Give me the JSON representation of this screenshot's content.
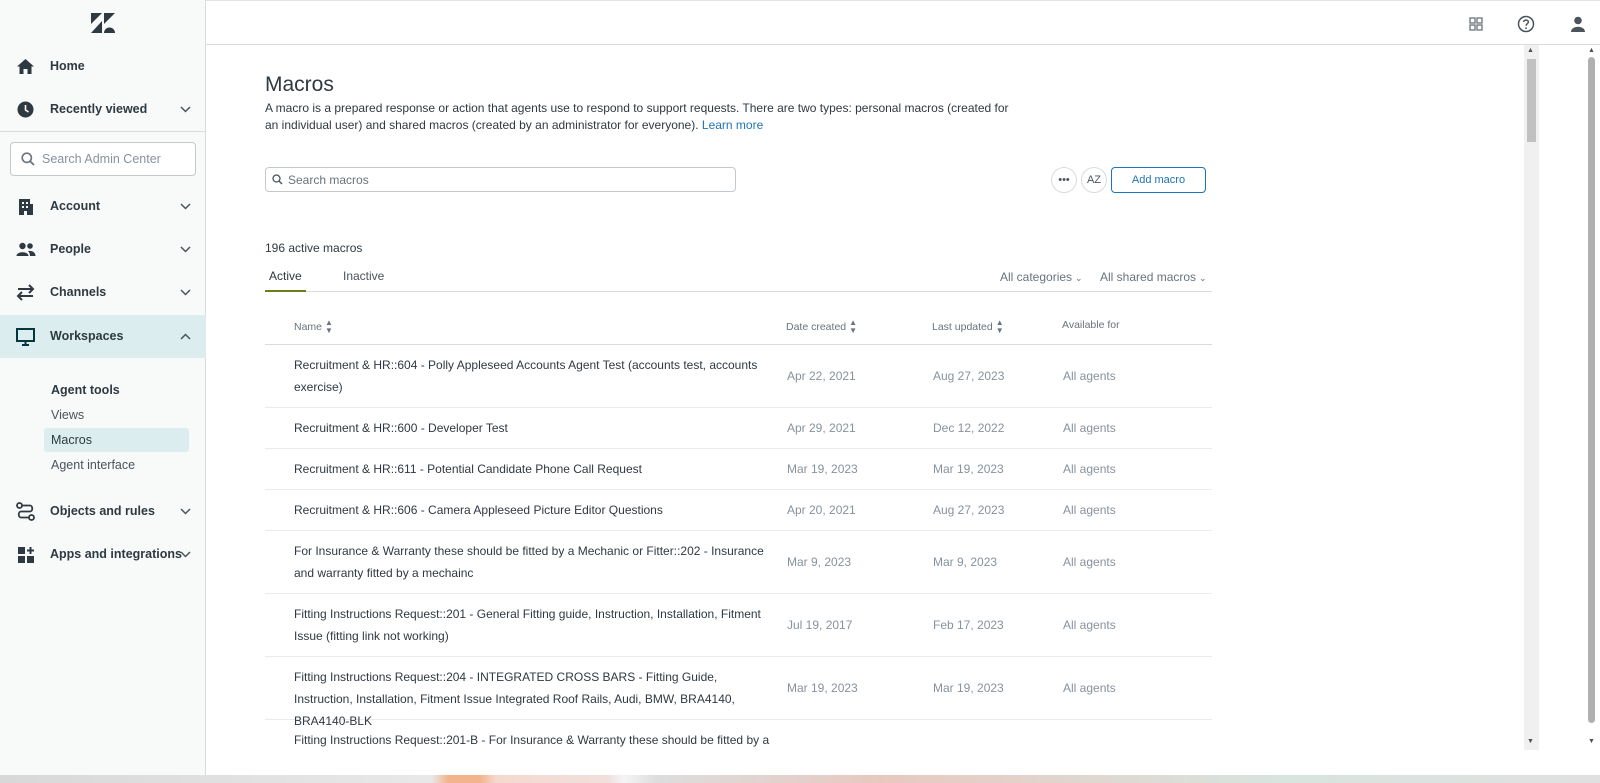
{
  "sidebar": {
    "logo": "zendesk-logo",
    "nav_top": [
      {
        "label": "Home",
        "icon": "home-icon"
      },
      {
        "label": "Recently viewed",
        "icon": "clock-icon"
      }
    ],
    "search_placeholder": "Search Admin Center",
    "nav": [
      {
        "label": "Account",
        "icon": "building-icon"
      },
      {
        "label": "People",
        "icon": "people-icon"
      },
      {
        "label": "Channels",
        "icon": "arrows-icon"
      },
      {
        "label": "Workspaces",
        "icon": "monitor-icon"
      },
      {
        "label": "Objects and rules",
        "icon": "route-icon"
      },
      {
        "label": "Apps and integrations",
        "icon": "apps-icon"
      }
    ],
    "workspaces_sub": {
      "heading": "Agent tools",
      "items": [
        "Views",
        "Macros",
        "Agent interface"
      ],
      "selected": "Macros"
    },
    "active_color": "#dbedee"
  },
  "topbar": {
    "icons": [
      "grid-icon",
      "help-icon",
      "user-icon"
    ]
  },
  "page": {
    "title": "Macros",
    "description": "A macro is a prepared response or action that agents use to respond to support requests. There are two types: personal macros (created for an individual user) and shared macros (created by an administrator for everyone).",
    "learn_more": "Learn more",
    "search_placeholder": "Search macros",
    "more_label": "•••",
    "sort_label": "AZ",
    "add_button": "Add macro",
    "count": "196 active macros",
    "tabs": [
      {
        "label": "Active",
        "active": true
      },
      {
        "label": "Inactive",
        "active": false
      }
    ],
    "filters": [
      "All categories",
      "All shared macros"
    ],
    "columns": [
      "Name",
      "Date created",
      "Last updated",
      "Available for"
    ],
    "rows": [
      {
        "name": "Recruitment & HR::604 - Polly Appleseed Accounts Agent Test (accounts test, accounts exercise)",
        "created": "Apr 22, 2021",
        "updated": "Aug 27, 2023",
        "available": "All agents"
      },
      {
        "name": "Recruitment & HR::600 - Developer Test",
        "created": "Apr 29, 2021",
        "updated": "Dec 12, 2022",
        "available": "All agents"
      },
      {
        "name": "Recruitment & HR::611 - Potential Candidate Phone Call Request",
        "created": "Mar 19, 2023",
        "updated": "Mar 19, 2023",
        "available": "All agents"
      },
      {
        "name": "Recruitment & HR::606 - Camera Appleseed Picture Editor Questions",
        "created": "Apr 20, 2021",
        "updated": "Aug 27, 2023",
        "available": "All agents"
      },
      {
        "name": "For Insurance & Warranty these should be fitted by a Mechanic or Fitter::202 - Insurance and warranty fitted by a mechainc",
        "created": "Mar 9, 2023",
        "updated": "Mar 9, 2023",
        "available": "All agents"
      },
      {
        "name": "Fitting Instructions Request::201 - General Fitting guide, Instruction, Installation, Fitment Issue (fitting link not working)",
        "created": "Jul 19, 2017",
        "updated": "Feb 17, 2023",
        "available": "All agents"
      },
      {
        "name": "Fitting Instructions Request::204 - INTEGRATED CROSS BARS - Fitting Guide, Instruction, Installation, Fitment Issue Integrated Roof Rails, Audi, BMW, BRA4140, BRA4140-BLK",
        "created": "Mar 19, 2023",
        "updated": "Mar 19, 2023",
        "available": "All agents"
      },
      {
        "name": "Fitting Instructions Request::201-B - For Insurance & Warranty these should be fitted by a",
        "created": "",
        "updated": "",
        "available": ""
      }
    ],
    "accent_color": "#1f73b7",
    "tab_underline_color": "#6b7d1d"
  }
}
